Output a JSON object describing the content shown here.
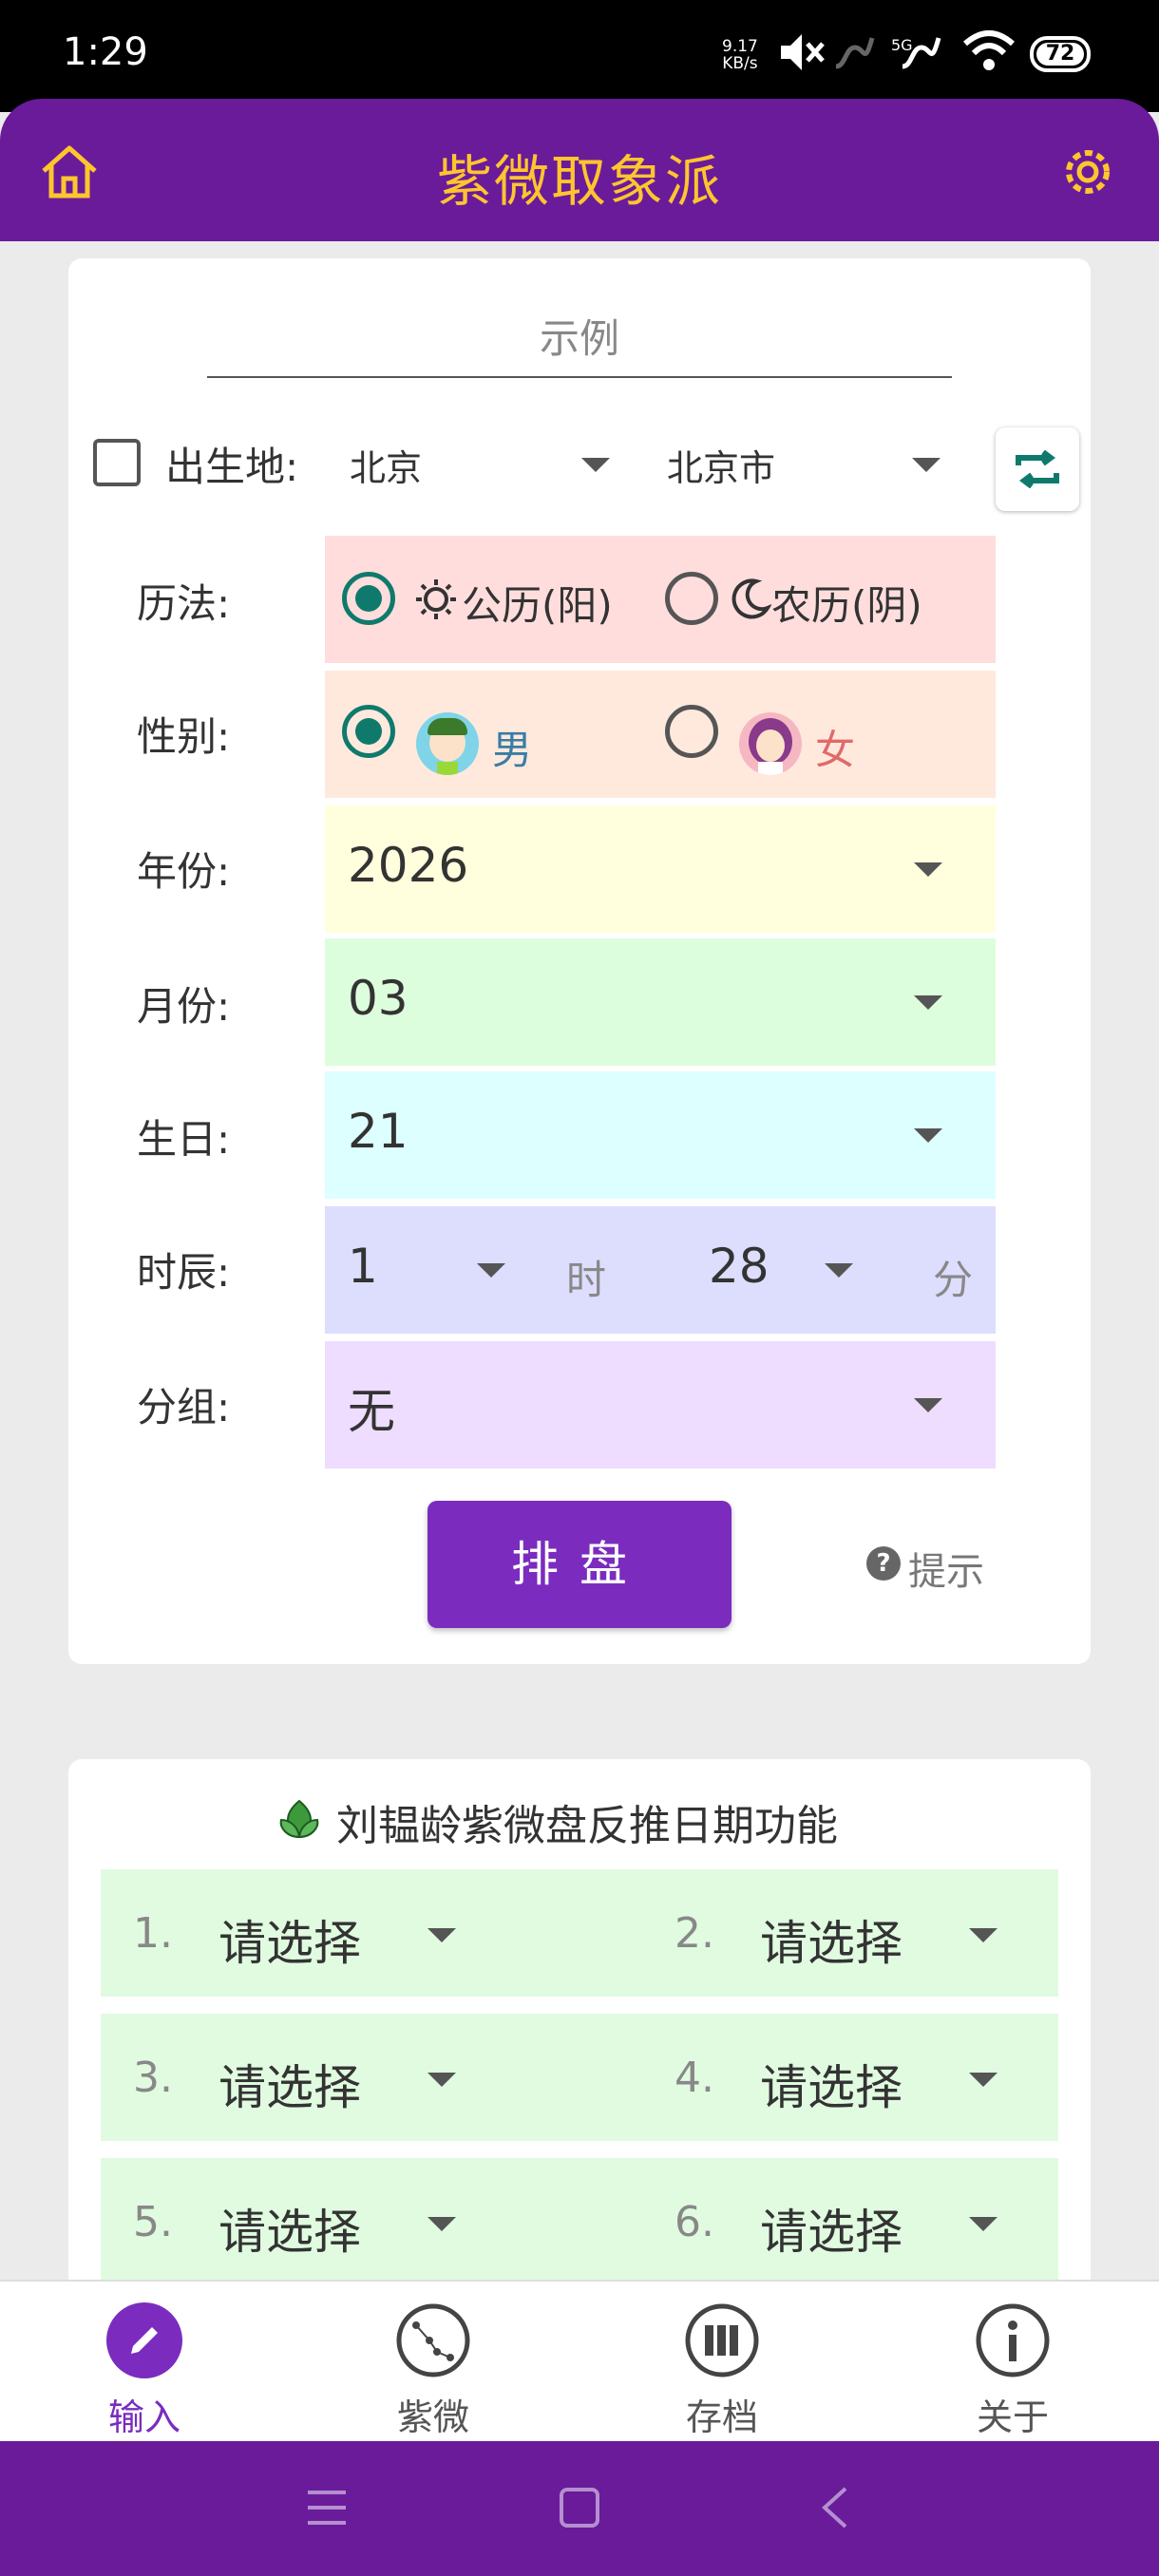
{
  "status": {
    "time": "1:29",
    "speed_value": "9.17",
    "speed_unit": "KB/s",
    "signal": "5G",
    "battery": "72"
  },
  "header": {
    "title": "紫微取象派",
    "home_icon": "home-icon",
    "settings_icon": "gear-icon"
  },
  "form": {
    "name_placeholder": "示例",
    "birthplace_label": "出生地:",
    "province": "北京",
    "city": "北京市",
    "calendar_label": "历法:",
    "calendar_solar": "公历(阳)",
    "calendar_lunar": "农历(阴)",
    "gender_label": "性别:",
    "gender_male": "男",
    "gender_female": "女",
    "year_label": "年份:",
    "year": "2026",
    "month_label": "月份:",
    "month": "03",
    "day_label": "生日:",
    "day": "21",
    "time_label": "时辰:",
    "hour": "1",
    "hour_unit": "时",
    "minute": "28",
    "minute_unit": "分",
    "group_label": "分组:",
    "group": "无",
    "submit": "排盘",
    "hint": "提示"
  },
  "reverse": {
    "title": "刘韫龄紫微盘反推日期功能",
    "items": [
      {
        "num": "1.",
        "value": "请选择"
      },
      {
        "num": "2.",
        "value": "请选择"
      },
      {
        "num": "3.",
        "value": "请选择"
      },
      {
        "num": "4.",
        "value": "请选择"
      },
      {
        "num": "5.",
        "value": "请选择"
      },
      {
        "num": "6.",
        "value": "请选择"
      }
    ]
  },
  "nav": {
    "items": [
      {
        "label": "输入",
        "icon": "pencil-icon"
      },
      {
        "label": "紫微",
        "icon": "constellation-icon"
      },
      {
        "label": "存档",
        "icon": "archive-icon"
      },
      {
        "label": "关于",
        "icon": "info-icon"
      }
    ],
    "active_color": "#7b2cbf"
  },
  "colors": {
    "header": "#6a1b9a",
    "title": "#ffc52e",
    "calendar_row": "#ffdddd",
    "gender_row": "#ffe9dd",
    "year_row": "#ffffdd",
    "month_row": "#ddfedd",
    "day_row": "#ddffff",
    "time_row": "#ddddfe",
    "group_row": "#eeddfe",
    "radio_on": "#0f7a6c"
  }
}
